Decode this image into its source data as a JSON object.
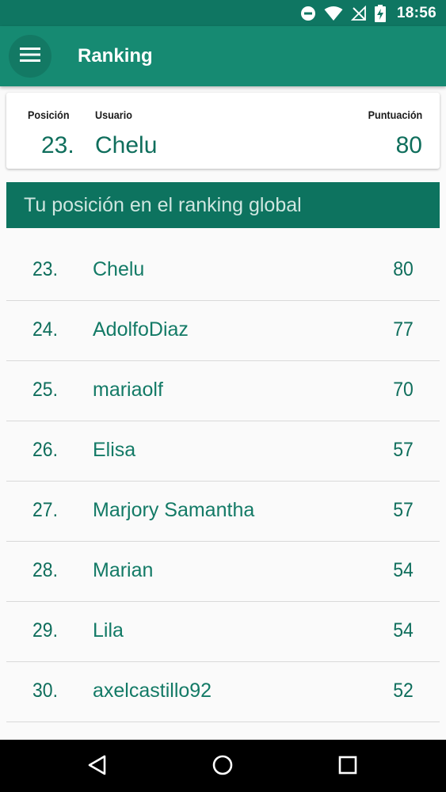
{
  "status_bar": {
    "time": "18:56",
    "icons": [
      "do-not-disturb-icon",
      "wifi-icon",
      "no-signal-icon",
      "battery-charging-icon"
    ]
  },
  "app_bar": {
    "title": "Ranking",
    "menu_icon": "hamburger-menu-icon"
  },
  "user_card": {
    "position_label": "Posición",
    "user_label": "Usuario",
    "score_label": "Puntuación",
    "position": "23.",
    "user": "Chelu",
    "score": "80"
  },
  "section": {
    "title": "Tu posición en el ranking global"
  },
  "ranking": [
    {
      "position": "23.",
      "name": "Chelu",
      "score": "80"
    },
    {
      "position": "24.",
      "name": "AdolfoDiaz",
      "score": "77"
    },
    {
      "position": "25.",
      "name": "mariaolf",
      "score": "70"
    },
    {
      "position": "26.",
      "name": "Elisa",
      "score": "57"
    },
    {
      "position": "27.",
      "name": "Marjory Samantha",
      "score": "57"
    },
    {
      "position": "28.",
      "name": "Marian",
      "score": "54"
    },
    {
      "position": "29.",
      "name": "Lila",
      "score": "54"
    },
    {
      "position": "30.",
      "name": "axelcastillo92",
      "score": "52"
    }
  ],
  "nav_bar": {
    "icons": [
      "back-icon",
      "home-icon",
      "recent-apps-icon"
    ]
  },
  "colors": {
    "status_bar": "#0f7662",
    "app_bar": "#168a72",
    "section_header": "#0d735f",
    "accent_text": "#0f6e5c"
  }
}
